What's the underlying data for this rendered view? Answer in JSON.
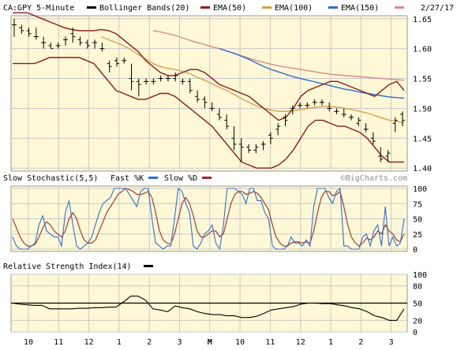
{
  "header": {
    "symbol": "CA:GPY 5-Minute",
    "date": "2/27/17",
    "watermark": "©BigCharts.com"
  },
  "legends": {
    "price": [
      {
        "label": "Bollinger Bands(20)",
        "color": "#000000"
      },
      {
        "label": "EMA(50)",
        "color": "#9a1a1a"
      },
      {
        "label": "EMA(100)",
        "color": "#d4a24a"
      },
      {
        "label": "EMA(150)",
        "color": "#2f6fd6"
      },
      {
        "label": "",
        "color": "#d98a8a"
      }
    ],
    "stochastic": {
      "title": "Slow Stochastic(5,5)",
      "fast_label": "Fast %K",
      "slow_label": "Slow %D"
    },
    "rsi": {
      "title": "Relative Strength Index(14)"
    }
  },
  "colors": {
    "plot_bg": "#fff8d6",
    "price_bar": "#000000",
    "bollinger": "#8b1a1a",
    "ema50": "#d4a24a",
    "ema100": "#2f6fd6",
    "ema150": "#d98a8a",
    "fast_k": "#2f6fd6",
    "slow_d": "#a52a2a",
    "rsi": "#000000"
  },
  "chart_data": [
    {
      "type": "line",
      "title": "CA:GPY 5-Minute",
      "ylim": [
        1.395,
        1.655
      ],
      "y_ticks": [
        1.4,
        1.45,
        1.5,
        1.55,
        1.6,
        1.65
      ],
      "y_tick_labels": [
        "1.40",
        "1.45",
        "1.50",
        "1.55",
        "1.60",
        "1.65"
      ],
      "x_tick_labels": [
        "10",
        "11",
        "12",
        "1",
        "2",
        "3",
        "M",
        "10",
        "11",
        "12",
        "1",
        "2",
        "3"
      ],
      "grid": true,
      "price_bars": [
        [
          1.64,
          1.65,
          1.62,
          1.64
        ],
        [
          1.635,
          1.64,
          1.625,
          1.63
        ],
        [
          1.63,
          1.635,
          1.62,
          1.625
        ],
        [
          1.62,
          1.635,
          1.615,
          1.62
        ],
        [
          1.61,
          1.62,
          1.6,
          1.61
        ],
        [
          1.605,
          1.61,
          1.6,
          1.6
        ],
        [
          1.605,
          1.61,
          1.6,
          1.605
        ],
        [
          1.615,
          1.62,
          1.605,
          1.615
        ],
        [
          1.625,
          1.635,
          1.61,
          1.62
        ],
        [
          1.615,
          1.62,
          1.605,
          1.61
        ],
        [
          1.61,
          1.615,
          1.6,
          1.605
        ],
        [
          1.61,
          1.615,
          1.6,
          1.61
        ],
        [
          1.6,
          1.61,
          1.595,
          1.6
        ],
        [
          1.575,
          1.58,
          1.56,
          1.57
        ],
        [
          1.58,
          1.585,
          1.57,
          1.575
        ],
        [
          1.58,
          1.585,
          1.575,
          1.58
        ],
        [
          1.55,
          1.575,
          1.53,
          1.545
        ],
        [
          1.545,
          1.55,
          1.52,
          1.54
        ],
        [
          1.545,
          1.55,
          1.54,
          1.545
        ],
        [
          1.545,
          1.55,
          1.54,
          1.545
        ],
        [
          1.55,
          1.555,
          1.545,
          1.55
        ],
        [
          1.55,
          1.555,
          1.545,
          1.55
        ],
        [
          1.55,
          1.56,
          1.545,
          1.555
        ],
        [
          1.545,
          1.55,
          1.54,
          1.545
        ],
        [
          1.545,
          1.55,
          1.525,
          1.53
        ],
        [
          1.52,
          1.53,
          1.51,
          1.515
        ],
        [
          1.515,
          1.52,
          1.5,
          1.51
        ],
        [
          1.5,
          1.51,
          1.495,
          1.5
        ],
        [
          1.49,
          1.5,
          1.48,
          1.485
        ],
        [
          1.48,
          1.49,
          1.465,
          1.47
        ],
        [
          1.45,
          1.47,
          1.43,
          1.44
        ],
        [
          1.44,
          1.45,
          1.41,
          1.435
        ],
        [
          1.435,
          1.44,
          1.425,
          1.43
        ],
        [
          1.43,
          1.44,
          1.425,
          1.435
        ],
        [
          1.44,
          1.445,
          1.43,
          1.44
        ],
        [
          1.455,
          1.46,
          1.44,
          1.45
        ],
        [
          1.465,
          1.475,
          1.455,
          1.47
        ],
        [
          1.485,
          1.49,
          1.47,
          1.48
        ],
        [
          1.5,
          1.505,
          1.49,
          1.5
        ],
        [
          1.505,
          1.51,
          1.5,
          1.505
        ],
        [
          1.505,
          1.51,
          1.5,
          1.505
        ],
        [
          1.51,
          1.515,
          1.505,
          1.51
        ],
        [
          1.51,
          1.515,
          1.505,
          1.51
        ],
        [
          1.5,
          1.51,
          1.495,
          1.5
        ],
        [
          1.495,
          1.5,
          1.49,
          1.495
        ],
        [
          1.49,
          1.5,
          1.485,
          1.49
        ],
        [
          1.485,
          1.49,
          1.48,
          1.485
        ],
        [
          1.475,
          1.485,
          1.47,
          1.48
        ],
        [
          1.465,
          1.475,
          1.46,
          1.465
        ],
        [
          1.45,
          1.46,
          1.44,
          1.445
        ],
        [
          1.42,
          1.435,
          1.41,
          1.415
        ],
        [
          1.42,
          1.43,
          1.41,
          1.425
        ],
        [
          1.475,
          1.485,
          1.46,
          1.48
        ],
        [
          1.49,
          1.495,
          1.47,
          1.48
        ]
      ],
      "series": [
        {
          "name": "Bollinger Upper",
          "values": [
            1.66,
            1.66,
            1.66,
            1.655,
            1.65,
            1.645,
            1.64,
            1.635,
            1.632,
            1.63,
            1.63,
            1.63,
            1.632,
            1.63,
            1.625,
            1.615,
            1.605,
            1.595,
            1.58,
            1.57,
            1.56,
            1.555,
            1.555,
            1.56,
            1.565,
            1.565,
            1.56,
            1.55,
            1.54,
            1.535,
            1.53,
            1.525,
            1.52,
            1.51,
            1.5,
            1.49,
            1.48,
            1.485,
            1.5,
            1.52,
            1.53,
            1.535,
            1.54,
            1.545,
            1.545,
            1.54,
            1.535,
            1.53,
            1.525,
            1.52,
            1.53,
            1.54,
            1.545,
            1.53
          ]
        },
        {
          "name": "Bollinger Lower",
          "values": [
            1.575,
            1.575,
            1.575,
            1.575,
            1.58,
            1.585,
            1.585,
            1.585,
            1.585,
            1.585,
            1.58,
            1.575,
            1.56,
            1.545,
            1.53,
            1.525,
            1.52,
            1.515,
            1.515,
            1.52,
            1.525,
            1.525,
            1.52,
            1.51,
            1.5,
            1.49,
            1.48,
            1.47,
            1.455,
            1.44,
            1.425,
            1.41,
            1.405,
            1.4,
            1.4,
            1.4,
            1.405,
            1.415,
            1.43,
            1.45,
            1.47,
            1.48,
            1.48,
            1.475,
            1.47,
            1.47,
            1.465,
            1.46,
            1.45,
            1.435,
            1.42,
            1.41,
            1.41,
            1.41
          ]
        },
        {
          "name": "EMA(50)",
          "values": [
            null,
            null,
            null,
            null,
            null,
            null,
            null,
            null,
            null,
            null,
            null,
            null,
            1.62,
            1.615,
            1.61,
            1.605,
            1.598,
            1.59,
            1.583,
            1.575,
            1.57,
            1.567,
            1.565,
            1.562,
            1.558,
            1.552,
            1.547,
            1.541,
            1.535,
            1.53,
            1.523,
            1.516,
            1.51,
            1.504,
            1.5,
            1.497,
            1.495,
            1.495,
            1.496,
            1.498,
            1.5,
            1.502,
            1.503,
            1.503,
            1.502,
            1.5,
            1.498,
            1.495,
            1.492,
            1.488,
            1.484,
            1.48,
            1.478,
            1.476
          ]
        },
        {
          "name": "EMA(100)",
          "values": [
            null,
            null,
            null,
            null,
            null,
            null,
            null,
            null,
            null,
            null,
            null,
            null,
            null,
            null,
            null,
            null,
            null,
            null,
            null,
            null,
            null,
            null,
            null,
            null,
            null,
            null,
            null,
            null,
            1.6,
            1.596,
            1.592,
            1.587,
            1.582,
            1.576,
            1.57,
            1.565,
            1.561,
            1.557,
            1.553,
            1.55,
            1.547,
            1.544,
            1.541,
            1.538,
            1.535,
            1.532,
            1.53,
            1.527,
            1.525,
            1.523,
            1.521,
            1.519,
            1.518,
            1.517
          ]
        },
        {
          "name": "EMA(150)",
          "values": [
            null,
            null,
            null,
            null,
            null,
            null,
            null,
            null,
            null,
            null,
            null,
            null,
            null,
            null,
            null,
            null,
            null,
            null,
            null,
            1.63,
            1.628,
            1.625,
            1.622,
            1.618,
            1.614,
            1.61,
            1.607,
            1.603,
            1.6,
            1.596,
            1.592,
            1.588,
            1.584,
            1.58,
            1.577,
            1.574,
            1.571,
            1.569,
            1.567,
            1.565,
            1.563,
            1.561,
            1.559,
            1.557,
            1.556,
            1.555,
            1.554,
            1.553,
            1.552,
            1.551,
            1.55,
            1.549,
            1.548,
            1.547
          ]
        }
      ]
    },
    {
      "type": "line",
      "title": "Slow Stochastic(5,5)",
      "ylim": [
        0,
        100
      ],
      "y_ticks": [
        0,
        25,
        50,
        75,
        100
      ],
      "y_tick_labels": [
        "0",
        "25",
        "50",
        "75",
        "100"
      ],
      "series": [
        {
          "name": "Fast %K",
          "values": [
            20,
            5,
            0,
            0,
            0,
            5,
            10,
            40,
            55,
            30,
            25,
            20,
            20,
            5,
            60,
            80,
            40,
            5,
            0,
            5,
            10,
            20,
            40,
            60,
            75,
            80,
            85,
            100,
            100,
            100,
            100,
            90,
            80,
            70,
            95,
            100,
            100,
            50,
            10,
            5,
            0,
            5,
            5,
            50,
            100,
            95,
            75,
            60,
            5,
            0,
            10,
            25,
            30,
            40,
            10,
            0,
            40,
            100,
            100,
            100,
            95,
            90,
            75,
            100,
            100,
            80,
            80,
            60,
            50,
            5,
            0,
            0,
            0,
            5,
            20,
            10,
            10,
            5,
            15,
            5,
            70,
            100,
            100,
            100,
            85,
            75,
            95,
            100,
            5,
            5,
            0,
            0,
            0,
            20,
            25,
            5,
            30,
            40,
            5,
            70,
            5,
            20,
            5,
            10,
            50
          ]
        },
        {
          "name": "Slow %D",
          "values": [
            50,
            35,
            20,
            10,
            5,
            5,
            8,
            20,
            35,
            45,
            40,
            30,
            25,
            20,
            30,
            50,
            60,
            50,
            30,
            15,
            10,
            10,
            15,
            30,
            45,
            60,
            70,
            80,
            90,
            95,
            100,
            98,
            95,
            90,
            90,
            92,
            95,
            85,
            60,
            30,
            15,
            10,
            8,
            25,
            50,
            75,
            85,
            75,
            55,
            30,
            20,
            20,
            25,
            30,
            30,
            20,
            25,
            50,
            75,
            90,
            95,
            95,
            90,
            92,
            95,
            92,
            85,
            75,
            65,
            40,
            20,
            10,
            5,
            5,
            10,
            12,
            12,
            10,
            12,
            10,
            30,
            60,
            85,
            95,
            95,
            88,
            90,
            95,
            70,
            40,
            20,
            10,
            5,
            10,
            18,
            15,
            20,
            30,
            25,
            40,
            30,
            25,
            15,
            12,
            25
          ]
        }
      ]
    },
    {
      "type": "line",
      "title": "Relative Strength Index(14)",
      "ylim": [
        0,
        100
      ],
      "y_ticks": [
        0,
        20,
        50,
        80,
        100
      ],
      "y_tick_labels": [
        "0",
        "20",
        "50",
        "80",
        "100"
      ],
      "reference_line": 50,
      "series": [
        {
          "name": "RSI(14)",
          "values": [
            50,
            48,
            47,
            46,
            46,
            40,
            40,
            40,
            40,
            41,
            41,
            42,
            42,
            43,
            43,
            52,
            62,
            62,
            55,
            40,
            38,
            35,
            45,
            42,
            40,
            35,
            32,
            30,
            30,
            28,
            28,
            25,
            25,
            27,
            32,
            38,
            40,
            42,
            44,
            48,
            50,
            50,
            49,
            49,
            47,
            45,
            42,
            40,
            35,
            28,
            25,
            20,
            20,
            40
          ]
        }
      ]
    }
  ]
}
